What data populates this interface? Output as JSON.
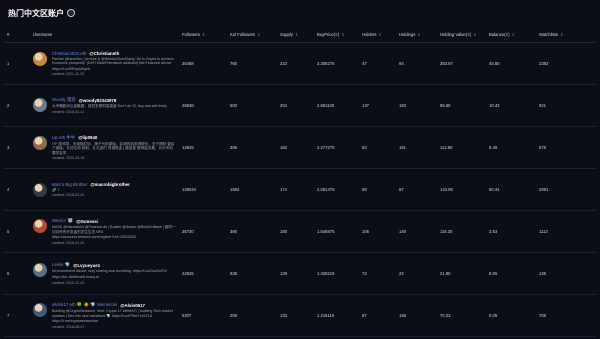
{
  "page": {
    "title": "热门中文区账户",
    "info_icon": "ⓘ"
  },
  "table": {
    "columns": [
      {
        "key": "rank",
        "label": "#",
        "sortable": false
      },
      {
        "key": "username",
        "label": "Username",
        "sortable": false
      },
      {
        "key": "followers",
        "label": "Followers",
        "sortable": true
      },
      {
        "key": "kol_followers",
        "label": "Kol Followers",
        "sortable": true
      },
      {
        "key": "supply",
        "label": "Supply",
        "sortable": true
      },
      {
        "key": "buy_price",
        "label": "BuyPrice(Ξ)",
        "sortable": true
      },
      {
        "key": "holders",
        "label": "Holders",
        "sortable": true
      },
      {
        "key": "holdings",
        "label": "Holdings",
        "sortable": true
      },
      {
        "key": "holding_value",
        "label": "Holding Value(Ξ)",
        "sortable": true
      },
      {
        "key": "balance",
        "label": "Balance(Ξ)",
        "sortable": true
      },
      {
        "key": "watchlists",
        "label": "Watchlists",
        "sortable": true
      }
    ],
    "sort_icon": "⇕",
    "rows": [
      {
        "rank": "1",
        "display_name": "Christian2022.eth",
        "handle": "@Christianeth",
        "bio": "Partner @NewGen_Venture & @WeirdoGhostGang \"All in Crypto to achieve Economic prosperity\" (DeFi Maxi/Friendtech addicted) Not Financial Advice",
        "link": "https://t.co/ERwyNIdynh",
        "created": "created: 2021-11-23",
        "followers": "26488",
        "kol_followers": "760",
        "supply": "222",
        "buy_price": "3.308275",
        "holders": "47",
        "holdings": "94",
        "holding_value": "383.97",
        "balance": "45.80",
        "watchlists": "2382",
        "avatar_color": "#c28a3a"
      },
      {
        "rank": "2",
        "display_name": "Woody 漫游",
        "handle": "@woody82343978",
        "bio": "大专嘴欧洲云金融圈，感觉多是财富高度 Don't do 32, buy and sell freely",
        "link": "",
        "created": "created: 2018-02-11",
        "followers": "29638",
        "kol_followers": "600",
        "supply": "204",
        "buy_price": "2.861100",
        "holders": "137",
        "holdings": "183",
        "holding_value": "96.68",
        "balance": "10.43",
        "watchlists": "921",
        "avatar_color": "#6b7a8c"
      },
      {
        "rank": "3",
        "display_name": "Lip.eth 牛牛",
        "handle": "@lip0940",
        "bio": "ITF 原领导，天驱碰红玩，精子代码原始，实测的话说得很忧，关于理财 曾给个链接，孔仲达和 我知，孔孔各们 低调推金 | 做信息 推荐量涂素，为币币的要学会学",
        "link": "",
        "created": "created: 2020-03-18",
        "followers": "13845",
        "kol_followers": "396",
        "supply": "182",
        "buy_price": "2.277275",
        "holders": "63",
        "holdings": "161",
        "holding_value": "112.89",
        "balance": "9.49",
        "watchlists": "578",
        "avatar_color": "#8a6d4b"
      },
      {
        "rank": "4",
        "display_name": "Macro Big Brother",
        "handle": "@macrobigbrother",
        "bio": "🔗 ⚡",
        "link": "",
        "created": "created: 2018-03-04",
        "followers": "129044",
        "kol_followers": "1684",
        "supply": "174",
        "buy_price": "2.081475",
        "holders": "59",
        "holdings": "67",
        "holding_value": "143.06",
        "balance": "60.44",
        "watchlists": "2991",
        "avatar_color": "#2f3a4a"
      },
      {
        "rank": "5",
        "display_name": "Messi⚡ 🐺",
        "handle": "@0xmessi",
        "bio": "MASK @Hanadkich @FinanceLab | Builder @Astam @BuildOnBase | 链同一切向所有开发者的发生生态 NFA",
        "link": "https://accounts.binance.com/register?ref=25023326",
        "created": "created: 2016-01-04",
        "followers": "26730",
        "kol_followers": "380",
        "supply": "150",
        "buy_price": "1.546875",
        "holders": "106",
        "holdings": "140",
        "holding_value": "116.30",
        "balance": "2.53",
        "watchlists": "1113",
        "avatar_color": "#b04a3a"
      },
      {
        "rank": "6",
        "display_name": "Leslie 💎",
        "handle": "@Lvyueyue1",
        "bio": "No investment advice, only sharing and recording. https://t.co/DccDvIFi2",
        "link": "https://lnr--5n89ww9i.fmary.ai",
        "created": "created: 2019-12-03",
        "followers": "22845",
        "kol_followers": "838",
        "supply": "139",
        "buy_price": "1.328219",
        "holders": "73",
        "holdings": "22",
        "holding_value": "21.85",
        "balance": "8.95",
        "watchlists": "138",
        "avatar_color": "#5a6f8a"
      },
      {
        "rank": "7",
        "display_name": "alvin617.eth 🍀 ☀️ 💎 Memecoin",
        "handle": "@Alvin0617",
        "bio": "Building @CryptoWeasesh, here: Crypto 17 #WebVC | building Tech market updates | Dev into new narratives 💎 https://t.co/PHnH 1e1FL8",
        "link": "https://t.me/cryptoweasechat",
        "created": "created: 2016-08-07",
        "followers": "6307",
        "kol_followers": "289",
        "supply": "133",
        "buy_price": "1.216119",
        "holders": "97",
        "holdings": "156",
        "holding_value": "70.23",
        "balance": "0.05",
        "watchlists": "708",
        "avatar_color": "#3d5c7a"
      }
    ]
  }
}
